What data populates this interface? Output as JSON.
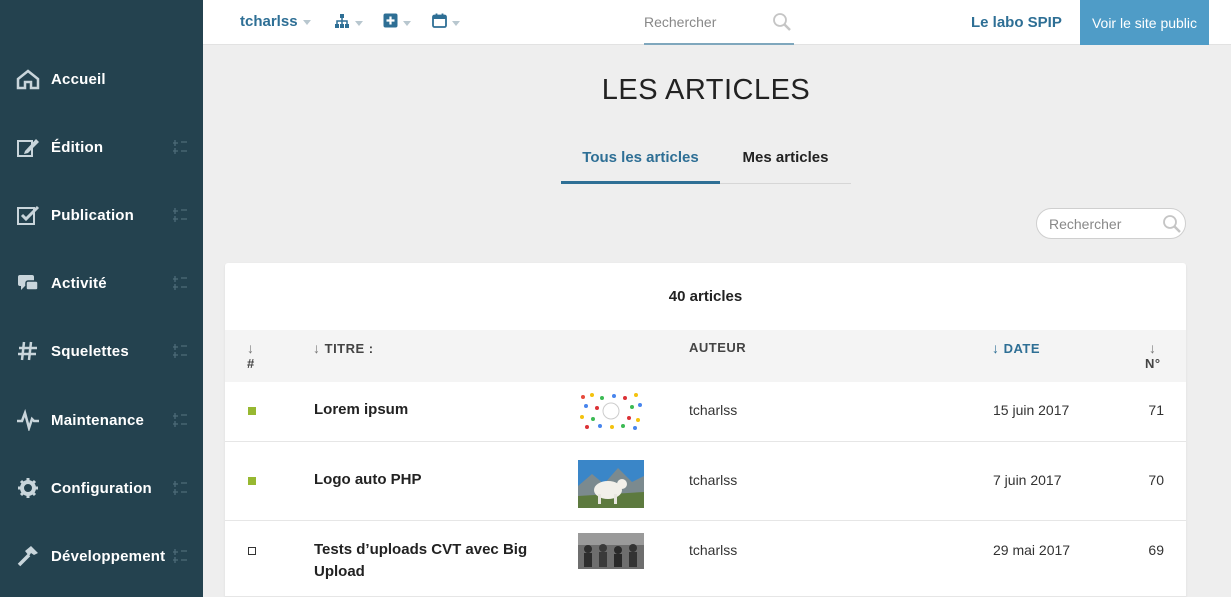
{
  "sidebar": {
    "items": [
      {
        "label": "Accueil"
      },
      {
        "label": "Édition"
      },
      {
        "label": "Publication"
      },
      {
        "label": "Activité"
      },
      {
        "label": "Squelettes"
      },
      {
        "label": "Maintenance"
      },
      {
        "label": "Configuration"
      },
      {
        "label": "Développement"
      }
    ]
  },
  "topbar": {
    "user": "tcharlss",
    "search_placeholder": "Rechercher",
    "site_name": "Le labo SPIP",
    "public_button": "Voir le site public"
  },
  "main": {
    "title": "LES ARTICLES",
    "tabs": [
      {
        "label": "Tous les articles",
        "active": true
      },
      {
        "label": "Mes articles",
        "active": false
      }
    ],
    "search_placeholder": "Rechercher",
    "count": "40 articles",
    "columns": {
      "status": "#",
      "title": "TITRE :",
      "author": "AUTEUR",
      "date": "DATE",
      "number": "N°"
    },
    "rows": [
      {
        "status": "publié",
        "title": "Lorem ipsum",
        "author": "tcharlss",
        "date": "15 juin 2017",
        "number": "71"
      },
      {
        "status": "publié",
        "title": "Logo auto PHP",
        "author": "tcharlss",
        "date": "7 juin 2017",
        "number": "70"
      },
      {
        "status": "brouillon",
        "title": "Tests d’uploads CVT avec Big Upload",
        "author": "tcharlss",
        "date": "29 mai 2017",
        "number": "69"
      }
    ]
  },
  "colors": {
    "sidebar_bg": "#24424f",
    "accent": "#2e6f95",
    "public_button_bg": "#4f9cc7",
    "published": "#97b831"
  }
}
